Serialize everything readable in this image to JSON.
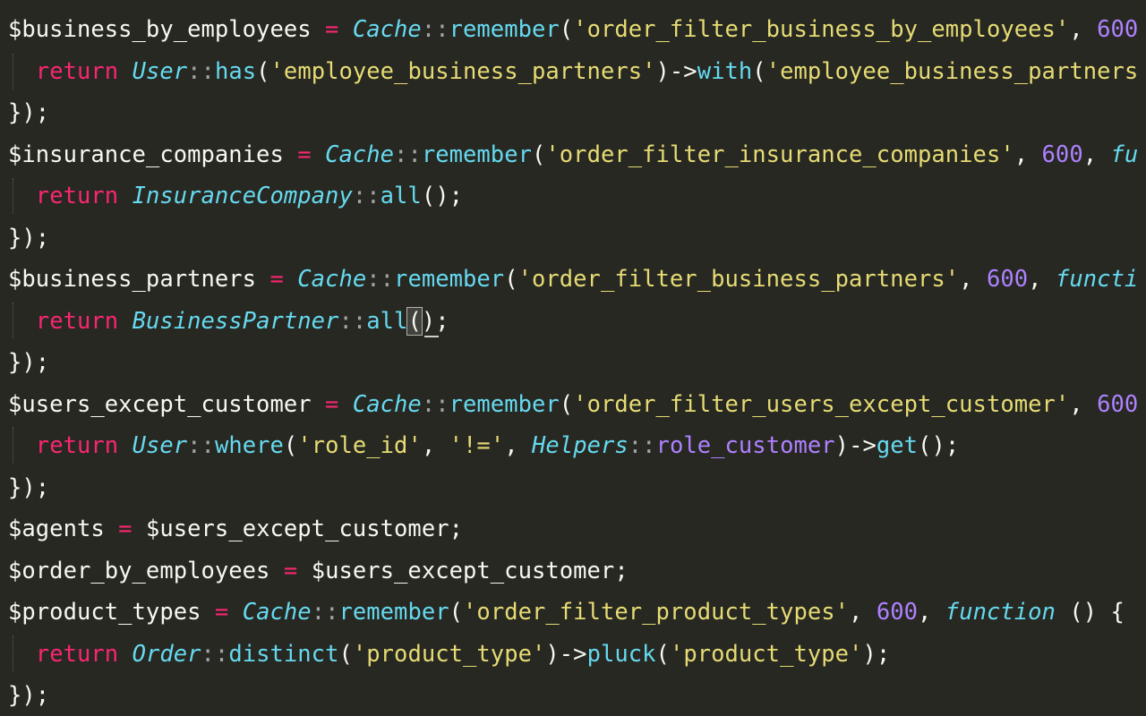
{
  "editor": {
    "colors": {
      "background": "#272822",
      "foreground": "#f8f8f2",
      "keyword": "#f92672",
      "class": "#66d9ef",
      "string": "#e6db74",
      "number": "#ae81ff"
    },
    "lines": [
      {
        "tokens": [
          {
            "t": "$business_by_employees",
            "k": "var"
          },
          {
            "t": " ",
            "k": "pun"
          },
          {
            "t": "=",
            "k": "op"
          },
          {
            "t": " ",
            "k": "pun"
          },
          {
            "t": "Cache",
            "k": "cls"
          },
          {
            "t": "::",
            "k": "dc"
          },
          {
            "t": "remember",
            "k": "fn"
          },
          {
            "t": "(",
            "k": "pun"
          },
          {
            "t": "'order_filter_business_by_employees'",
            "k": "str"
          },
          {
            "t": ", ",
            "k": "pun"
          },
          {
            "t": "600",
            "k": "num"
          }
        ]
      },
      {
        "tokens": [
          {
            "t": "  ",
            "k": "pun"
          },
          {
            "t": "return",
            "k": "kw"
          },
          {
            "t": " ",
            "k": "pun"
          },
          {
            "t": "User",
            "k": "cls"
          },
          {
            "t": "::",
            "k": "dc"
          },
          {
            "t": "has",
            "k": "fn"
          },
          {
            "t": "(",
            "k": "pun"
          },
          {
            "t": "'employee_business_partners'",
            "k": "str"
          },
          {
            "t": ")->",
            "k": "pun"
          },
          {
            "t": "with",
            "k": "fn"
          },
          {
            "t": "(",
            "k": "pun"
          },
          {
            "t": "'employee_business_partners",
            "k": "str"
          }
        ]
      },
      {
        "tokens": [
          {
            "t": "});",
            "k": "pun"
          }
        ]
      },
      {
        "tokens": [
          {
            "t": "$insurance_companies",
            "k": "var"
          },
          {
            "t": " ",
            "k": "pun"
          },
          {
            "t": "=",
            "k": "op"
          },
          {
            "t": " ",
            "k": "pun"
          },
          {
            "t": "Cache",
            "k": "cls"
          },
          {
            "t": "::",
            "k": "dc"
          },
          {
            "t": "remember",
            "k": "fn"
          },
          {
            "t": "(",
            "k": "pun"
          },
          {
            "t": "'order_filter_insurance_companies'",
            "k": "str"
          },
          {
            "t": ", ",
            "k": "pun"
          },
          {
            "t": "600",
            "k": "num"
          },
          {
            "t": ", ",
            "k": "pun"
          },
          {
            "t": "fu",
            "k": "stg"
          }
        ]
      },
      {
        "tokens": [
          {
            "t": "  ",
            "k": "pun"
          },
          {
            "t": "return",
            "k": "kw"
          },
          {
            "t": " ",
            "k": "pun"
          },
          {
            "t": "InsuranceCompany",
            "k": "cls"
          },
          {
            "t": "::",
            "k": "dc"
          },
          {
            "t": "all",
            "k": "fn"
          },
          {
            "t": "();",
            "k": "pun"
          }
        ]
      },
      {
        "tokens": [
          {
            "t": "});",
            "k": "pun"
          }
        ]
      },
      {
        "tokens": [
          {
            "t": "$business_partners",
            "k": "var"
          },
          {
            "t": " ",
            "k": "pun"
          },
          {
            "t": "=",
            "k": "op"
          },
          {
            "t": " ",
            "k": "pun"
          },
          {
            "t": "Cache",
            "k": "cls"
          },
          {
            "t": "::",
            "k": "dc"
          },
          {
            "t": "remember",
            "k": "fn"
          },
          {
            "t": "(",
            "k": "pun"
          },
          {
            "t": "'order_filter_business_partners'",
            "k": "str"
          },
          {
            "t": ", ",
            "k": "pun"
          },
          {
            "t": "600",
            "k": "num"
          },
          {
            "t": ", ",
            "k": "pun"
          },
          {
            "t": "functi",
            "k": "stg"
          }
        ]
      },
      {
        "tokens": [
          {
            "t": "  ",
            "k": "pun"
          },
          {
            "t": "return",
            "k": "kw"
          },
          {
            "t": " ",
            "k": "pun"
          },
          {
            "t": "BusinessPartner",
            "k": "cls"
          },
          {
            "t": "::",
            "k": "dc"
          },
          {
            "t": "all",
            "k": "fn"
          },
          {
            "t": "(",
            "k": "pun",
            "match": true
          },
          {
            "t": ");",
            "k": "pun"
          }
        ]
      },
      {
        "tokens": [
          {
            "t": "});",
            "k": "pun"
          }
        ]
      },
      {
        "tokens": [
          {
            "t": "$users_except_customer",
            "k": "var"
          },
          {
            "t": " ",
            "k": "pun"
          },
          {
            "t": "=",
            "k": "op"
          },
          {
            "t": " ",
            "k": "pun"
          },
          {
            "t": "Cache",
            "k": "cls"
          },
          {
            "t": "::",
            "k": "dc"
          },
          {
            "t": "remember",
            "k": "fn"
          },
          {
            "t": "(",
            "k": "pun"
          },
          {
            "t": "'order_filter_users_except_customer'",
            "k": "str"
          },
          {
            "t": ", ",
            "k": "pun"
          },
          {
            "t": "600",
            "k": "num"
          }
        ]
      },
      {
        "tokens": [
          {
            "t": "  ",
            "k": "pun"
          },
          {
            "t": "return",
            "k": "kw"
          },
          {
            "t": " ",
            "k": "pun"
          },
          {
            "t": "User",
            "k": "cls"
          },
          {
            "t": "::",
            "k": "dc"
          },
          {
            "t": "where",
            "k": "fn"
          },
          {
            "t": "(",
            "k": "pun"
          },
          {
            "t": "'role_id'",
            "k": "str"
          },
          {
            "t": ", ",
            "k": "pun"
          },
          {
            "t": "'!='",
            "k": "str"
          },
          {
            "t": ", ",
            "k": "pun"
          },
          {
            "t": "Helpers",
            "k": "cls"
          },
          {
            "t": "::",
            "k": "dc"
          },
          {
            "t": "role_customer",
            "k": "const"
          },
          {
            "t": ")->",
            "k": "pun"
          },
          {
            "t": "get",
            "k": "fn"
          },
          {
            "t": "();",
            "k": "pun"
          }
        ]
      },
      {
        "tokens": [
          {
            "t": "});",
            "k": "pun"
          }
        ]
      },
      {
        "tokens": [
          {
            "t": "$agents",
            "k": "var"
          },
          {
            "t": " ",
            "k": "pun"
          },
          {
            "t": "=",
            "k": "op"
          },
          {
            "t": " ",
            "k": "pun"
          },
          {
            "t": "$users_except_customer",
            "k": "var"
          },
          {
            "t": ";",
            "k": "pun"
          }
        ]
      },
      {
        "tokens": [
          {
            "t": "$order_by_employees",
            "k": "var"
          },
          {
            "t": " ",
            "k": "pun"
          },
          {
            "t": "=",
            "k": "op"
          },
          {
            "t": " ",
            "k": "pun"
          },
          {
            "t": "$users_except_customer",
            "k": "var"
          },
          {
            "t": ";",
            "k": "pun"
          }
        ]
      },
      {
        "tokens": [
          {
            "t": "$product_types",
            "k": "var"
          },
          {
            "t": " ",
            "k": "pun"
          },
          {
            "t": "=",
            "k": "op"
          },
          {
            "t": " ",
            "k": "pun"
          },
          {
            "t": "Cache",
            "k": "cls"
          },
          {
            "t": "::",
            "k": "dc"
          },
          {
            "t": "remember",
            "k": "fn"
          },
          {
            "t": "(",
            "k": "pun"
          },
          {
            "t": "'order_filter_product_types'",
            "k": "str"
          },
          {
            "t": ", ",
            "k": "pun"
          },
          {
            "t": "600",
            "k": "num"
          },
          {
            "t": ", ",
            "k": "pun"
          },
          {
            "t": "function",
            "k": "stg"
          },
          {
            "t": " () {",
            "k": "pun"
          }
        ]
      },
      {
        "tokens": [
          {
            "t": "  ",
            "k": "pun"
          },
          {
            "t": "return",
            "k": "kw"
          },
          {
            "t": " ",
            "k": "pun"
          },
          {
            "t": "Order",
            "k": "cls"
          },
          {
            "t": "::",
            "k": "dc"
          },
          {
            "t": "distinct",
            "k": "fn"
          },
          {
            "t": "(",
            "k": "pun"
          },
          {
            "t": "'product_type'",
            "k": "str"
          },
          {
            "t": ")->",
            "k": "pun"
          },
          {
            "t": "pluck",
            "k": "fn"
          },
          {
            "t": "(",
            "k": "pun"
          },
          {
            "t": "'product_type'",
            "k": "str"
          },
          {
            "t": ");",
            "k": "pun"
          }
        ]
      },
      {
        "tokens": [
          {
            "t": "});",
            "k": "pun"
          }
        ]
      }
    ]
  }
}
